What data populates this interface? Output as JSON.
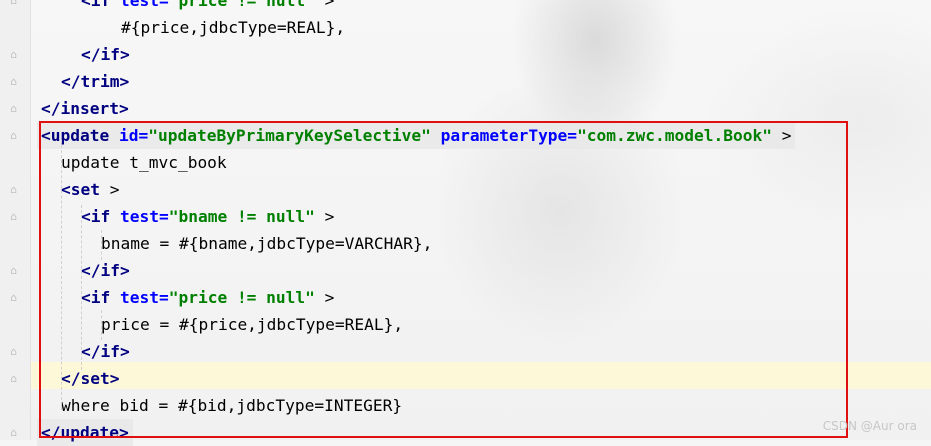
{
  "lines": [
    {
      "indent": "  ",
      "parts": [
        [
          "t",
          "<if "
        ],
        [
          "a",
          "test="
        ],
        [
          "v",
          "\"price != null\""
        ],
        [
          "p",
          " >"
        ]
      ]
    },
    {
      "indent": "    ",
      "parts": [
        [
          "p",
          "#{price,jdbcType=REAL},"
        ]
      ]
    },
    {
      "indent": "  ",
      "parts": [
        [
          "t",
          "</if>"
        ]
      ]
    },
    {
      "indent": " ",
      "parts": [
        [
          "t",
          "</trim>"
        ]
      ]
    },
    {
      "indent": "",
      "parts": [
        [
          "t",
          "</insert>"
        ]
      ]
    },
    {
      "indent": "",
      "parts": [
        [
          "t",
          "<update "
        ],
        [
          "a",
          "id="
        ],
        [
          "v",
          "\"updateByPrimaryKeySelective\""
        ],
        [
          "p",
          " "
        ],
        [
          "a",
          "parameterType="
        ],
        [
          "v",
          "\"com.zwc.model.Book\""
        ],
        [
          "p",
          " >"
        ]
      ]
    },
    {
      "indent": " ",
      "parts": [
        [
          "p",
          "update t_mvc_book"
        ]
      ]
    },
    {
      "indent": " ",
      "parts": [
        [
          "t",
          "<set"
        ],
        [
          "p",
          " >"
        ]
      ]
    },
    {
      "indent": "  ",
      "parts": [
        [
          "t",
          "<if "
        ],
        [
          "a",
          "test="
        ],
        [
          "v",
          "\"bname != null\""
        ],
        [
          "p",
          " >"
        ]
      ]
    },
    {
      "indent": "   ",
      "parts": [
        [
          "p",
          "bname = #{bname,jdbcType=VARCHAR},"
        ]
      ]
    },
    {
      "indent": "  ",
      "parts": [
        [
          "t",
          "</if>"
        ]
      ]
    },
    {
      "indent": "  ",
      "parts": [
        [
          "t",
          "<if "
        ],
        [
          "a",
          "test="
        ],
        [
          "v",
          "\"price != null\""
        ],
        [
          "p",
          " >"
        ]
      ]
    },
    {
      "indent": "   ",
      "parts": [
        [
          "p",
          "price = #{price,jdbcType=REAL},"
        ]
      ]
    },
    {
      "indent": "  ",
      "parts": [
        [
          "t",
          "</if>"
        ]
      ]
    },
    {
      "indent": " ",
      "parts": [
        [
          "t",
          "</set>"
        ]
      ]
    },
    {
      "indent": " ",
      "parts": [
        [
          "p",
          "where bid = #{bid,jdbcType=INTEGER}"
        ]
      ]
    },
    {
      "indent": "",
      "parts": [
        [
          "t",
          "</update>"
        ]
      ]
    }
  ],
  "watermark": "CSDN @Aur ora"
}
